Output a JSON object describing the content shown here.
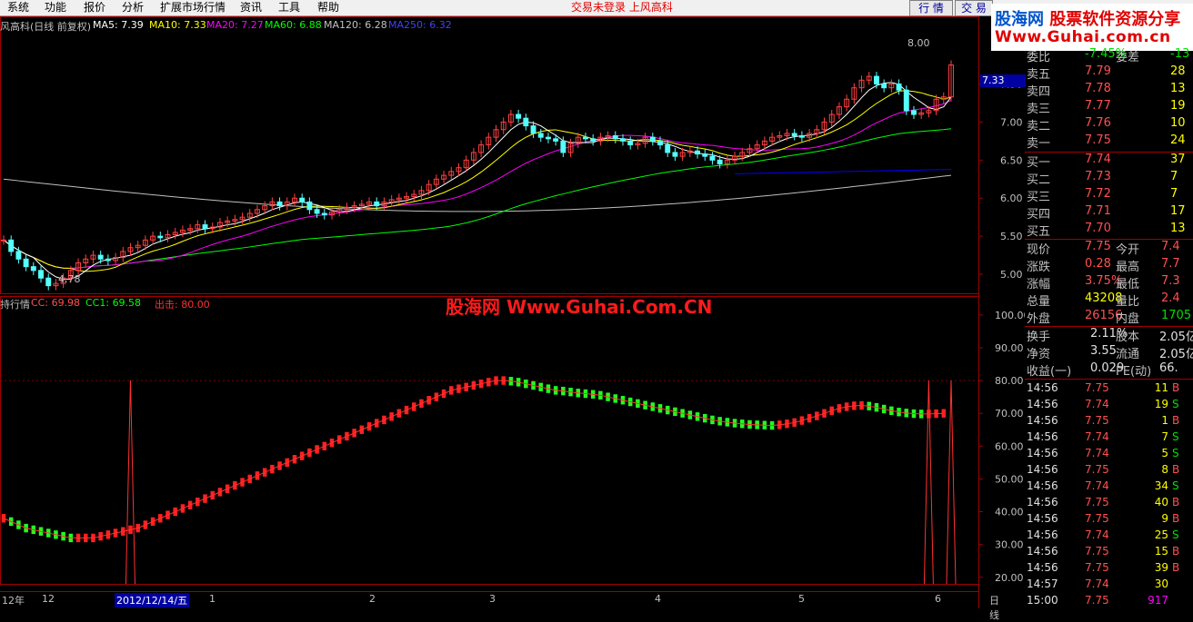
{
  "menubar": {
    "items": [
      "系统",
      "功能",
      "报价",
      "分析",
      "扩展市场行情",
      "资讯",
      "工具",
      "帮助"
    ],
    "status": "交易未登录   上风高科",
    "tabs": [
      "行 情",
      "交 易"
    ]
  },
  "logo": {
    "name_a": "股海网",
    "name_b": "股票软件资源分享",
    "url": "Www.Guhai.com.cn"
  },
  "main_header": {
    "title": "风高科(日线 前复权)",
    "ma5": "MA5: 7.39",
    "ma10": "MA10: 7.33",
    "ma20": "MA20: 7.27",
    "ma60": "MA60: 6.88",
    "ma120": "MA120: 6.28",
    "ma250": "MA250: 6.32",
    "high_label": "8.00",
    "low_label": "4.78",
    "price_marker": "7.33"
  },
  "indicator_header": {
    "title": "持行情",
    "cc": "CC: 69.98",
    "cc1": "CC1: 69.58",
    "exit": "出击: 80.00"
  },
  "watermark": "股海网 Www.Guhai.Com.CN",
  "colors": {
    "ma5": "#ffffff",
    "ma10": "#ffff00",
    "ma20": "#ff00ff",
    "ma60": "#00ff00",
    "ma120": "#c0c0c0",
    "ma250": "#0000ff",
    "up": "#ff4040",
    "down": "#54ffff"
  },
  "price_axis": [
    "7.50",
    "7.00",
    "6.50",
    "6.00",
    "5.50",
    "5.00"
  ],
  "ind_axis": [
    "100.00",
    "90.00",
    "80.00",
    "70.00",
    "60.00",
    "50.00",
    "40.00",
    "30.00",
    "20.00"
  ],
  "x_axis": [
    "12年",
    "12",
    "2012/12/14/五",
    "1",
    "2",
    "3",
    "4",
    "5",
    "6",
    "日线"
  ],
  "quote": {
    "order_ratio": {
      "label": "委比",
      "value": "-7.45%",
      "label2": "委差",
      "value2": "-13"
    },
    "asks": [
      {
        "label": "卖五",
        "price": "7.79",
        "vol": "28"
      },
      {
        "label": "卖四",
        "price": "7.78",
        "vol": "13"
      },
      {
        "label": "卖三",
        "price": "7.77",
        "vol": "19"
      },
      {
        "label": "卖二",
        "price": "7.76",
        "vol": "10"
      },
      {
        "label": "卖一",
        "price": "7.75",
        "vol": "24"
      }
    ],
    "bids": [
      {
        "label": "买一",
        "price": "7.74",
        "vol": "37"
      },
      {
        "label": "买二",
        "price": "7.73",
        "vol": "7"
      },
      {
        "label": "买三",
        "price": "7.72",
        "vol": "7"
      },
      {
        "label": "买四",
        "price": "7.71",
        "vol": "17"
      },
      {
        "label": "买五",
        "price": "7.70",
        "vol": "13"
      }
    ],
    "stats": [
      {
        "l1": "现价",
        "v1": "7.75",
        "c1": "red",
        "l2": "今开",
        "v2": "7.4",
        "c2": "red"
      },
      {
        "l1": "涨跌",
        "v1": "0.28",
        "c1": "red",
        "l2": "最高",
        "v2": "7.7",
        "c2": "red"
      },
      {
        "l1": "涨幅",
        "v1": "3.75%",
        "c1": "red",
        "l2": "最低",
        "v2": "7.3",
        "c2": "red"
      },
      {
        "l1": "总量",
        "v1": "43208",
        "c1": "yel",
        "l2": "量比",
        "v2": "2.4",
        "c2": "red"
      },
      {
        "l1": "外盘",
        "v1": "26156",
        "c1": "red",
        "l2": "内盘",
        "v2": "1705",
        "c2": "grn"
      }
    ],
    "fin": [
      {
        "l1": "换手",
        "v1": "2.11%",
        "l2": "股本",
        "v2": "2.05亿"
      },
      {
        "l1": "净资",
        "v1": "3.55",
        "l2": "流通",
        "v2": "2.05亿"
      },
      {
        "l1": "收益(一)",
        "v1": "0.029",
        "l2": "PE(动)",
        "v2": "66."
      }
    ],
    "ticks": [
      {
        "t": "14:56",
        "p": "7.75",
        "v": "11",
        "s": "B"
      },
      {
        "t": "14:56",
        "p": "7.74",
        "v": "19",
        "s": "S"
      },
      {
        "t": "14:56",
        "p": "7.75",
        "v": "1",
        "s": "B"
      },
      {
        "t": "14:56",
        "p": "7.74",
        "v": "7",
        "s": "S"
      },
      {
        "t": "14:56",
        "p": "7.74",
        "v": "5",
        "s": "S"
      },
      {
        "t": "14:56",
        "p": "7.75",
        "v": "8",
        "s": "B"
      },
      {
        "t": "14:56",
        "p": "7.74",
        "v": "34",
        "s": "S"
      },
      {
        "t": "14:56",
        "p": "7.75",
        "v": "40",
        "s": "B"
      },
      {
        "t": "14:56",
        "p": "7.75",
        "v": "9",
        "s": "B"
      },
      {
        "t": "14:56",
        "p": "7.74",
        "v": "25",
        "s": "S"
      },
      {
        "t": "14:56",
        "p": "7.75",
        "v": "15",
        "s": "B"
      },
      {
        "t": "14:56",
        "p": "7.75",
        "v": "39",
        "s": "B"
      },
      {
        "t": "14:57",
        "p": "7.74",
        "v": "30",
        "s": ""
      },
      {
        "t": "15:00",
        "p": "7.75",
        "v": "917",
        "s": ""
      }
    ]
  },
  "chart_data": {
    "type": "candlestick",
    "closes": [
      5.45,
      5.3,
      5.2,
      5.1,
      5.05,
      4.95,
      4.85,
      4.88,
      4.95,
      5.05,
      5.15,
      5.2,
      5.25,
      5.2,
      5.18,
      5.22,
      5.3,
      5.35,
      5.38,
      5.45,
      5.5,
      5.48,
      5.52,
      5.55,
      5.58,
      5.6,
      5.65,
      5.6,
      5.62,
      5.68,
      5.7,
      5.72,
      5.75,
      5.8,
      5.85,
      5.9,
      5.95,
      5.9,
      5.95,
      6.0,
      5.95,
      5.85,
      5.8,
      5.78,
      5.82,
      5.85,
      5.88,
      5.9,
      5.92,
      5.95,
      5.9,
      5.95,
      5.98,
      6.0,
      6.02,
      6.05,
      6.1,
      6.18,
      6.25,
      6.3,
      6.35,
      6.4,
      6.5,
      6.6,
      6.7,
      6.8,
      6.9,
      7.0,
      7.1,
      7.05,
      6.95,
      6.85,
      6.8,
      6.78,
      6.75,
      6.6,
      6.72,
      6.8,
      6.78,
      6.75,
      6.8,
      6.82,
      6.78,
      6.75,
      6.7,
      6.72,
      6.8,
      6.75,
      6.7,
      6.6,
      6.55,
      6.6,
      6.62,
      6.58,
      6.55,
      6.5,
      6.45,
      6.5,
      6.55,
      6.6,
      6.65,
      6.7,
      6.75,
      6.8,
      6.82,
      6.85,
      6.82,
      6.8,
      6.85,
      6.9,
      7.0,
      7.1,
      7.2,
      7.3,
      7.45,
      7.55,
      7.6,
      7.5,
      7.45,
      7.5,
      7.42,
      7.15,
      7.1,
      7.12,
      7.15,
      7.3,
      7.33,
      7.75
    ],
    "ind_cc": [
      38,
      37,
      36,
      35,
      34.5,
      34,
      33.5,
      33,
      32.5,
      32,
      32,
      32,
      32,
      32.5,
      33,
      33.5,
      34,
      34.5,
      35,
      36,
      37,
      38,
      39,
      40,
      41,
      42,
      43,
      44,
      45,
      46,
      47,
      48,
      49,
      50,
      51,
      52,
      53,
      54,
      55,
      56,
      57,
      58,
      59,
      60,
      61,
      62,
      63,
      64,
      65,
      66,
      67,
      68,
      69,
      70,
      71,
      72,
      73,
      74,
      75,
      76,
      77,
      77.5,
      78,
      78.5,
      79,
      79.5,
      80,
      80,
      79.8,
      79.5,
      79,
      78.5,
      78,
      77.5,
      77,
      76.8,
      76.5,
      76.2,
      76,
      75.8,
      75.5,
      75,
      74.5,
      74,
      73.5,
      73,
      72.5,
      72,
      71.5,
      71,
      70.5,
      70,
      69.5,
      69,
      68.5,
      68,
      67.6,
      67.3,
      67,
      66.8,
      66.6,
      66.5,
      66.4,
      66.3,
      66.5,
      66.8,
      67.2,
      67.8,
      68.5,
      69.2,
      70,
      70.8,
      71.5,
      72,
      72.3,
      72.4,
      72.2,
      71.8,
      71.3,
      70.8,
      70.4,
      70.1,
      69.9,
      69.8,
      69.8,
      69.9,
      70
    ],
    "ind_exit_peaks": [
      17,
      124,
      127
    ],
    "ylim_price": [
      4.75,
      8.15
    ],
    "ylim_ind": [
      18,
      103
    ]
  }
}
